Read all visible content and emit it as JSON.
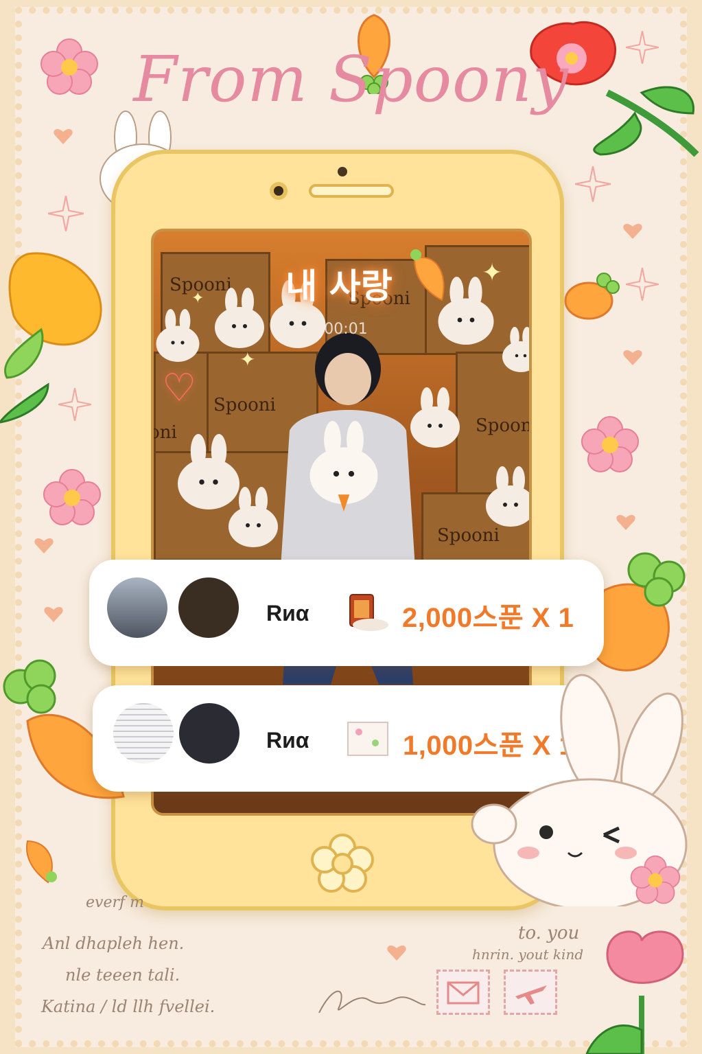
{
  "header": {
    "title": "From Spoony"
  },
  "screen": {
    "title": "내 사랑",
    "timer": "00:01",
    "box_labels": [
      "Spooni",
      "Spooni",
      "Spooni",
      "Spooni",
      "Spooni",
      "Spooni",
      "Spooni"
    ]
  },
  "notifications": [
    {
      "name": "Rиα",
      "amount": "2,000스푼 X 1"
    },
    {
      "name": "Rиα",
      "amount": "1,000스푼 X 1"
    }
  ],
  "letter": {
    "to": "to. you",
    "to_sub": "hnrin. yout kind",
    "lines": [
      "everf m",
      "Anl dhapleh hen.",
      "nle teeen tali.",
      "Katina / ld llh fvellei."
    ]
  },
  "colors": {
    "title": "#e58aa0",
    "amount": "#f07a2a",
    "phone": "#ffe39a"
  }
}
